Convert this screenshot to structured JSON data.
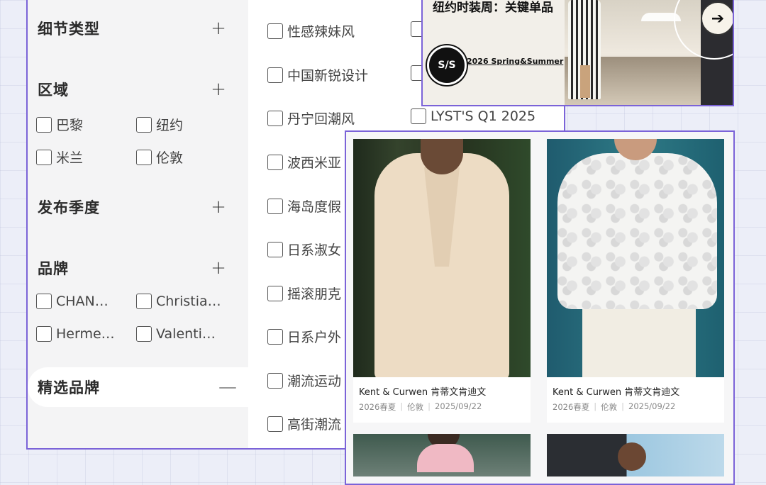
{
  "sidebar": {
    "sections": [
      {
        "title": "细节类型",
        "toggle": "+"
      },
      {
        "title": "区域",
        "toggle": "+"
      },
      {
        "title": "发布季度",
        "toggle": "+"
      },
      {
        "title": "品牌",
        "toggle": "+"
      },
      {
        "title": "精选品牌",
        "toggle": "—"
      }
    ],
    "regions": [
      "巴黎",
      "纽约",
      "米兰",
      "伦敦"
    ],
    "brands": [
      "CHAN…",
      "Christia…",
      "Herme…",
      "Valenti…"
    ]
  },
  "styles": {
    "col1": [
      "性感辣妹风",
      "中国新锐设计",
      "丹宁回潮风",
      "波西米亚",
      "海岛度假",
      "日系淑女",
      "摇滚朋克",
      "日系户外",
      "潮流运动",
      "高街潮流"
    ],
    "col2_visible": [
      "LYST'S Q1 2025"
    ]
  },
  "banner": {
    "title": "纽约时装周：关键单品",
    "logo": "S/S",
    "season": "2026 Spring&Summer",
    "arrow": "➔"
  },
  "products": [
    {
      "brand": "Kent & Curwen 肯蒂文肯迪文",
      "season": "2026春夏",
      "city": "伦敦",
      "date": "2025/09/22"
    },
    {
      "brand": "Kent & Curwen 肯蒂文肯迪文",
      "season": "2026春夏",
      "city": "伦敦",
      "date": "2025/09/22"
    }
  ],
  "colors": {
    "accent": "#7b63d8",
    "sidebar_bg": "#f4f4f5",
    "page_bg": "#eceef8"
  }
}
